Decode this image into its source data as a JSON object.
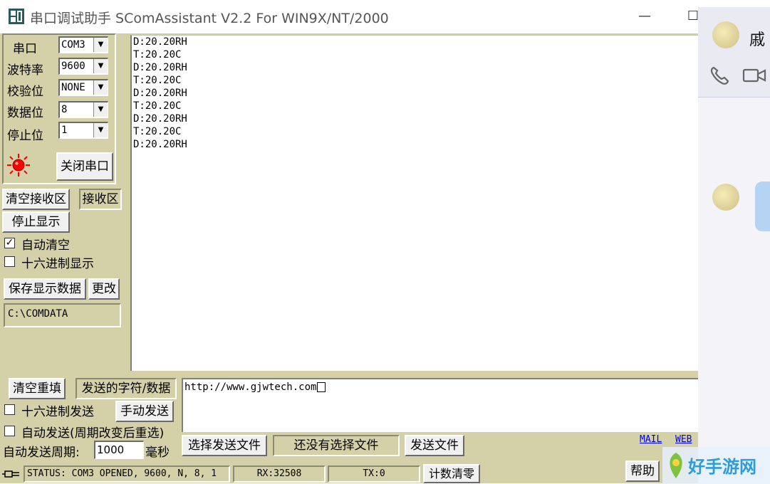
{
  "window": {
    "title": "串口调试助手 SComAssistant V2.2 For WIN9X/NT/2000",
    "minimize_glyph": "—",
    "maximize_glyph": "☐"
  },
  "serial": {
    "port_label": "串口",
    "port_value": "COM3",
    "baud_label": "波特率",
    "baud_value": "9600",
    "parity_label": "校验位",
    "parity_value": "NONE",
    "databits_label": "数据位",
    "databits_value": "8",
    "stopbits_label": "停止位",
    "stopbits_value": "1",
    "close_port": "关闭串口",
    "status_led_color": "#ff0000"
  },
  "receive": {
    "clear_button": "清空接收区",
    "area_label": "接收区",
    "stop_display": "停止显示",
    "auto_clear": "自动清空",
    "auto_clear_checked": true,
    "hex_display": "十六进制显示",
    "hex_display_checked": false,
    "save_button": "保存显示数据",
    "change_button": "更改",
    "save_path": "C:\\COMDATA",
    "lines": [
      "D:20.20RH",
      "T:20.20C",
      "D:20.20RH",
      "T:20.20C",
      "D:20.20RH",
      "T:20.20C",
      "D:20.20RH",
      "T:20.20C",
      "D:20.20RH"
    ]
  },
  "send": {
    "clear_button": "清空重填",
    "area_label": "发送的字符/数据",
    "hex_send": "十六进制发送",
    "manual_send": "手动发送",
    "auto_send": "自动发送(周期改变后重选)",
    "period_label": "自动发送周期:",
    "period_value": "1000",
    "period_unit": "毫秒",
    "content": "http://www.gjwtech.com",
    "select_file": "选择发送文件",
    "file_status": "还没有选择文件",
    "send_file": "发送文件",
    "mail_link": "MAIL",
    "web_link": "WEB"
  },
  "status": {
    "status_text": "STATUS: COM3 OPENED, 9600, N, 8, 1",
    "rx_text": "RX:32508",
    "tx_text": "TX:0",
    "reset_count": "计数清零",
    "help_button": "帮助"
  },
  "side_panel": {
    "contact_name": "戚",
    "watermark": "好手游网"
  }
}
